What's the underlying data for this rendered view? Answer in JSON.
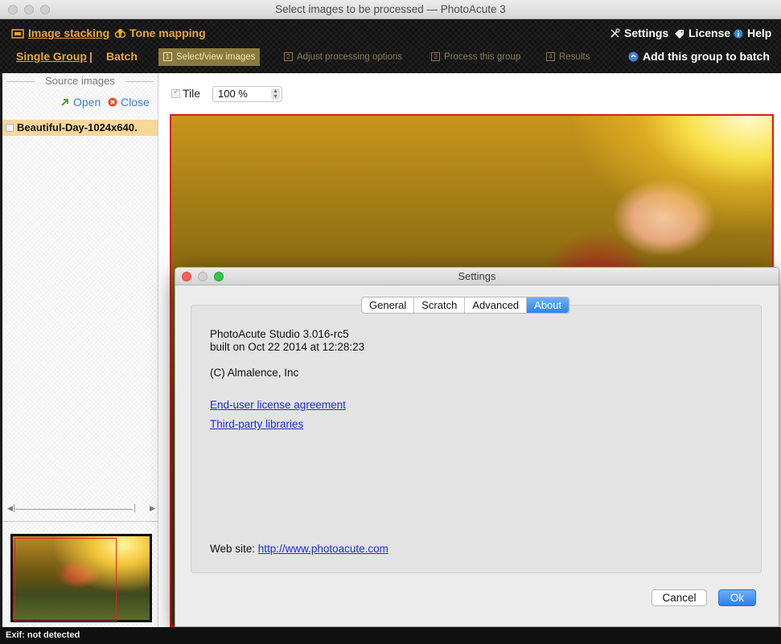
{
  "window": {
    "title": "Select images to be processed — PhotoAcute 3"
  },
  "header": {
    "image_stacking": "Image stacking",
    "tone_mapping": "Tone mapping",
    "settings": "Settings",
    "license": "License",
    "help": "Help",
    "single_group": "Single Group",
    "separator": "|",
    "batch": "Batch",
    "add_to_batch": "Add this group to batch",
    "steps": [
      {
        "num": "1",
        "label": "Select/view images",
        "active": true
      },
      {
        "num": "2",
        "label": "Adjust processing options",
        "active": false
      },
      {
        "num": "3",
        "label": "Process this group",
        "active": false
      },
      {
        "num": "4",
        "label": "Results",
        "active": false
      }
    ]
  },
  "left_panel": {
    "title": "Source images",
    "open": "Open",
    "close": "Close",
    "files": [
      {
        "name": "Beautiful-Day-1024x640.",
        "selected": true
      }
    ]
  },
  "toolbar": {
    "tile_label": "Tile",
    "tile_checked": true,
    "zoom": "100 %"
  },
  "dialog": {
    "title": "Settings",
    "tabs": [
      "General",
      "Scratch",
      "Advanced",
      "About"
    ],
    "active_tab": "About",
    "version": "PhotoAcute Studio 3.016-rc5",
    "built": "built on Oct 22 2014 at 12:28:23",
    "copyright": "(C) Almalence, Inc",
    "eula_link": "End-user license agreement",
    "third_party_link": "Third-party libraries",
    "website_label": "Web site:",
    "website_url": "http://www.photoacute.com",
    "cancel": "Cancel",
    "ok": "Ok"
  },
  "status": {
    "exif": "Exif: not detected"
  },
  "colors": {
    "accent": "#e8a63a",
    "selection_border": "#e11818",
    "link": "#1a2fcf",
    "primary_button": "#2f83f1"
  }
}
